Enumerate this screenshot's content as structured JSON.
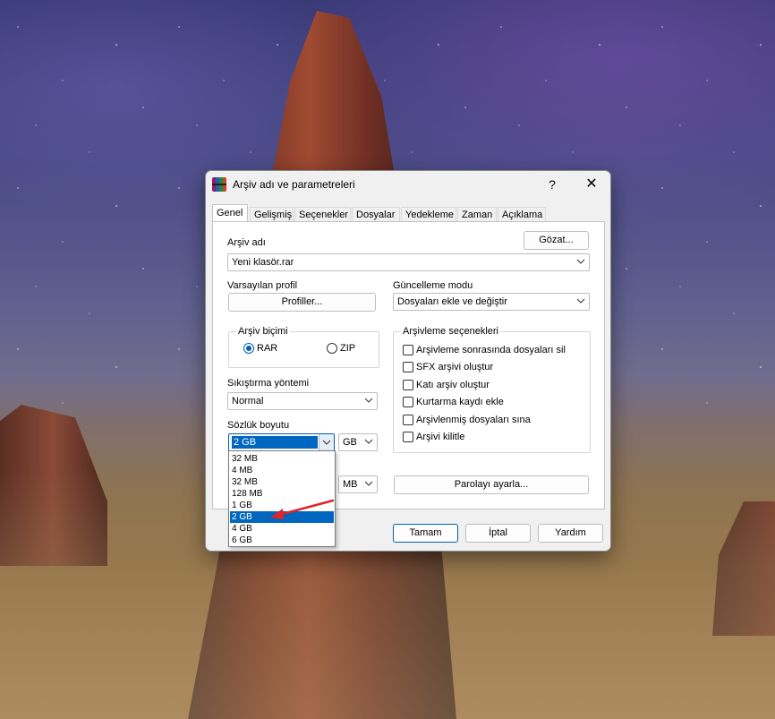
{
  "dialog": {
    "title": "Arşiv adı ve parametreleri",
    "help": "?",
    "close": "✕"
  },
  "tabs": [
    {
      "label": "Genel",
      "active": true
    },
    {
      "label": "Gelişmiş"
    },
    {
      "label": "Seçenekler"
    },
    {
      "label": "Dosyalar"
    },
    {
      "label": "Yedekleme"
    },
    {
      "label": "Zaman"
    },
    {
      "label": "Açıklama"
    }
  ],
  "archive": {
    "name_label": "Arşiv adı",
    "browse": "Gözat...",
    "name_value": "Yeni klasör.rar"
  },
  "profile": {
    "label": "Varsayılan profil",
    "button": "Profiller..."
  },
  "update": {
    "label": "Güncelleme modu",
    "value": "Dosyaları ekle ve değiştir"
  },
  "format": {
    "label": "Arşiv biçimi",
    "rar": "RAR",
    "zip": "ZIP",
    "selected": "RAR"
  },
  "options": {
    "label": "Arşivleme seçenekleri",
    "items": [
      "Arşivleme sonrasında dosyaları sil",
      "SFX arşivi oluştur",
      "Katı arşiv oluştur",
      "Kurtarma kaydı ekle",
      "Arşivlenmiş dosyaları sına",
      "Arşivi kilitle"
    ]
  },
  "compression": {
    "label": "Sıkıştırma yöntemi",
    "value": "Normal"
  },
  "dictionary": {
    "label": "Sözlük boyutu",
    "value": "2 GB",
    "unit": "GB",
    "options": [
      "32 MB",
      "4 MB",
      "32 MB",
      "128 MB",
      "1 GB",
      "2 GB",
      "4 GB",
      "6 GB"
    ],
    "selected_index": 5
  },
  "split": {
    "unit": "MB"
  },
  "password_button": "Parolayı ayarla...",
  "footer": {
    "ok": "Tamam",
    "cancel": "İptal",
    "help": "Yardım"
  },
  "colors": {
    "accent": "#0067c0",
    "annotation_arrow": "#e0242a"
  }
}
